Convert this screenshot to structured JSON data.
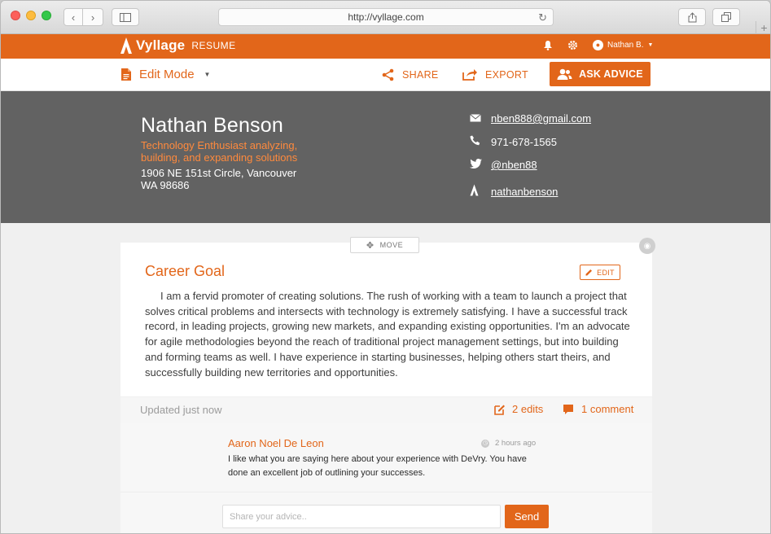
{
  "browser": {
    "url": "http://vyllage.com"
  },
  "app": {
    "brand": "Vyllage",
    "brand_sub": "RESUME",
    "user_name": "Nathan B.",
    "accent_color": "#e2661a"
  },
  "toolbar": {
    "mode_label": "Edit Mode",
    "share_label": "SHARE",
    "export_label": "EXPORT",
    "ask_label": "ASK ADVICE"
  },
  "profile": {
    "name": "Nathan Benson",
    "tagline": "Technology Enthusiast analyzing, building, and expanding solutions",
    "address_line1": "1906 NE 151st Circle, Vancouver",
    "address_line2": "WA 98686",
    "email": "nben888@gmail.com",
    "phone": "971-678-1565",
    "twitter": "@nben88",
    "website": "nathanbenson"
  },
  "section": {
    "move_label": "MOVE",
    "title": "Career Goal",
    "edit_label": "EDIT",
    "body": "I am a fervid promoter of creating solutions. The rush of working with a team to launch a project that solves critical problems and intersects with technology is extremely satisfying. I have a successful track record, in leading projects, growing new markets, and expanding existing opportunities. I'm an advocate for agile methodologies beyond the reach of traditional project management settings, but into building and forming teams as well. I have experience in starting businesses, helping others start theirs, and successfully building new territories and opportunities.",
    "updated": "Updated just now",
    "edits_count": "2 edits",
    "comments_count": "1 comment"
  },
  "comment": {
    "author": "Aaron Noel De Leon",
    "time": "2 hours ago",
    "text": "I like what you are saying here about your experience with DeVry. You have done an excellent job of outlining your successes."
  },
  "advice": {
    "placeholder": "Share your advice..",
    "send_label": "Send"
  }
}
